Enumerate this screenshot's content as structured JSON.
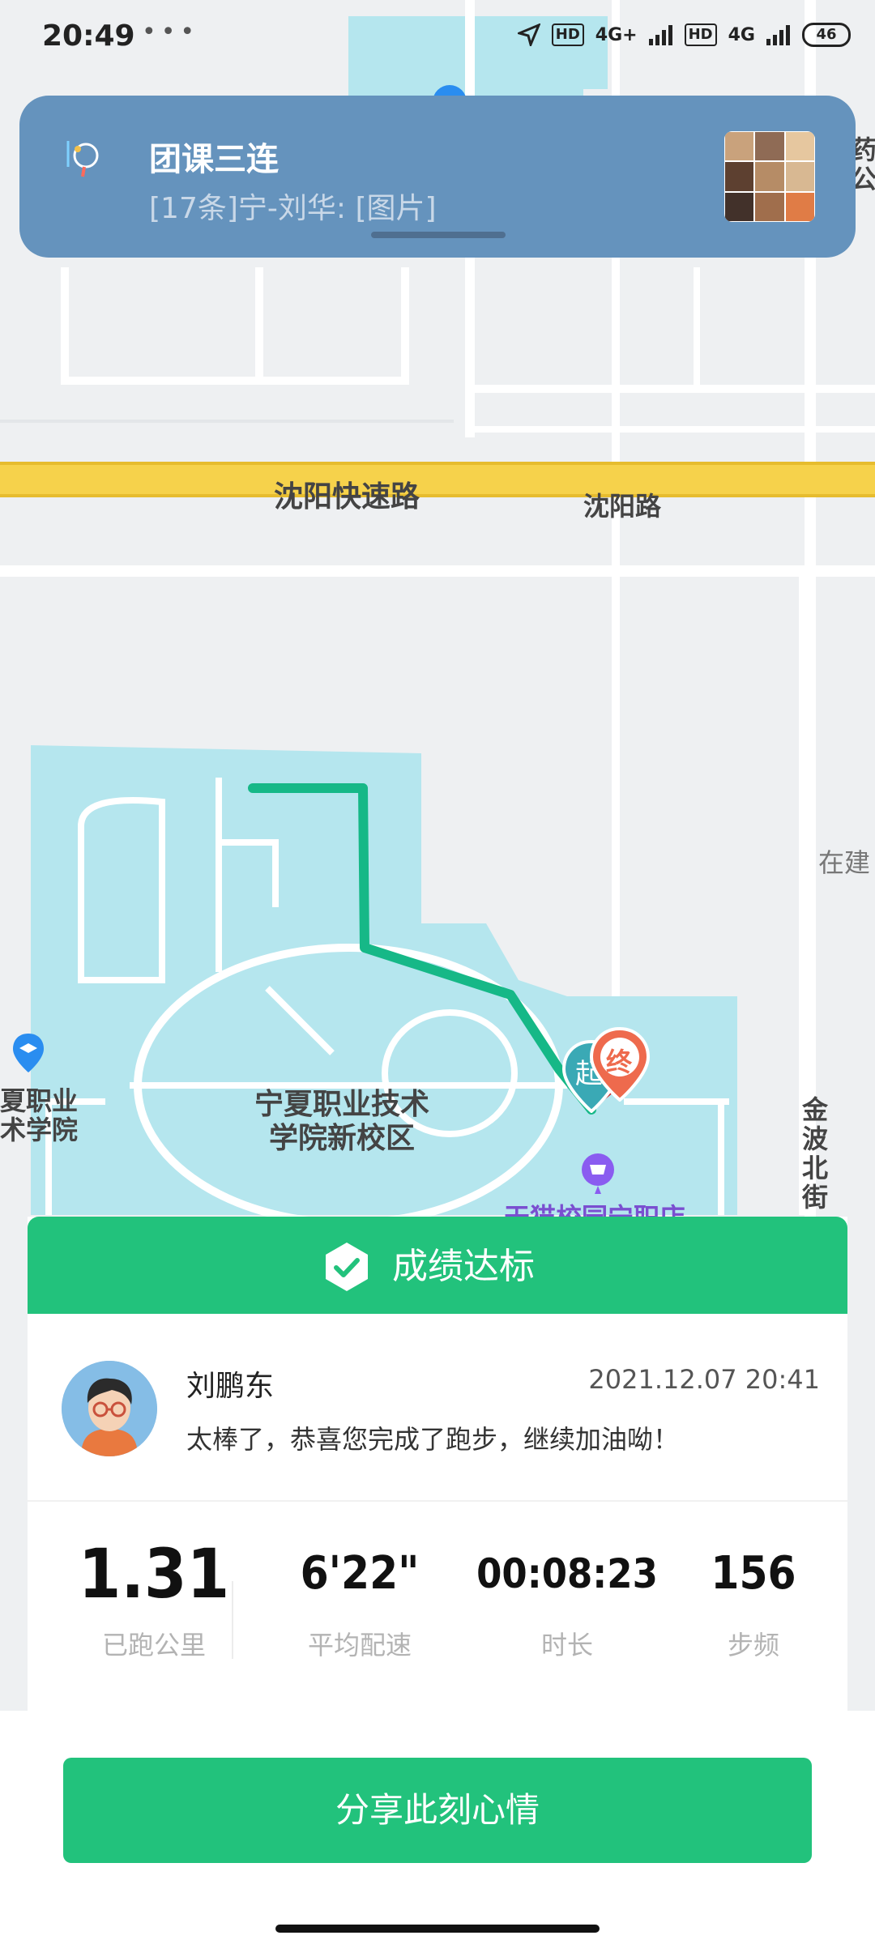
{
  "status_bar": {
    "time": "20:49",
    "dots": "•••",
    "hd1": "HD",
    "net1": "4G+",
    "hd2": "HD",
    "net2": "4G",
    "battery": "46"
  },
  "notification": {
    "title": "团课三连",
    "text": "[17条]宁-刘华: [图片]",
    "icon": "chat-app-icon",
    "thumb_colors": [
      "#c9a27c",
      "#8f6b55",
      "#e6c79f",
      "#5d4030",
      "#b68c66",
      "#d8b892",
      "#42312a",
      "#a06e4c",
      "#e07c46"
    ]
  },
  "map": {
    "labels": {
      "expressway": "沈阳快速路",
      "road": "沈阳路",
      "under_construction": "在建",
      "street": "金波北街",
      "school_left_line1": "夏职业",
      "school_left_line2": "术学院",
      "campus_line1": "宁夏职业技术",
      "campus_line2": "学院新校区",
      "shop": "天猫校园宁职店",
      "start_marker": "起",
      "end_marker": "终",
      "right_edge_1": "药",
      "right_edge_2": "公"
    },
    "colors": {
      "route": "#16b887",
      "water": "#b5e6ee",
      "road": "#ffffff",
      "expressway": "#f6d24b",
      "end_marker": "#ee6a4d",
      "start_marker": "#3aa9b5"
    }
  },
  "result": {
    "header": "成绩达标",
    "user_name": "刘鹏东",
    "datetime": "2021.12.07 20:41",
    "message": "太棒了，恭喜您完成了跑步，继续加油呦！",
    "stats": [
      {
        "value": "1.31",
        "label": "已跑公里"
      },
      {
        "value": "6'22\"",
        "label": "平均配速"
      },
      {
        "value": "00:08:23",
        "label": "时长"
      },
      {
        "value": "156",
        "label": "步频"
      }
    ]
  },
  "share_button": "分享此刻心情"
}
